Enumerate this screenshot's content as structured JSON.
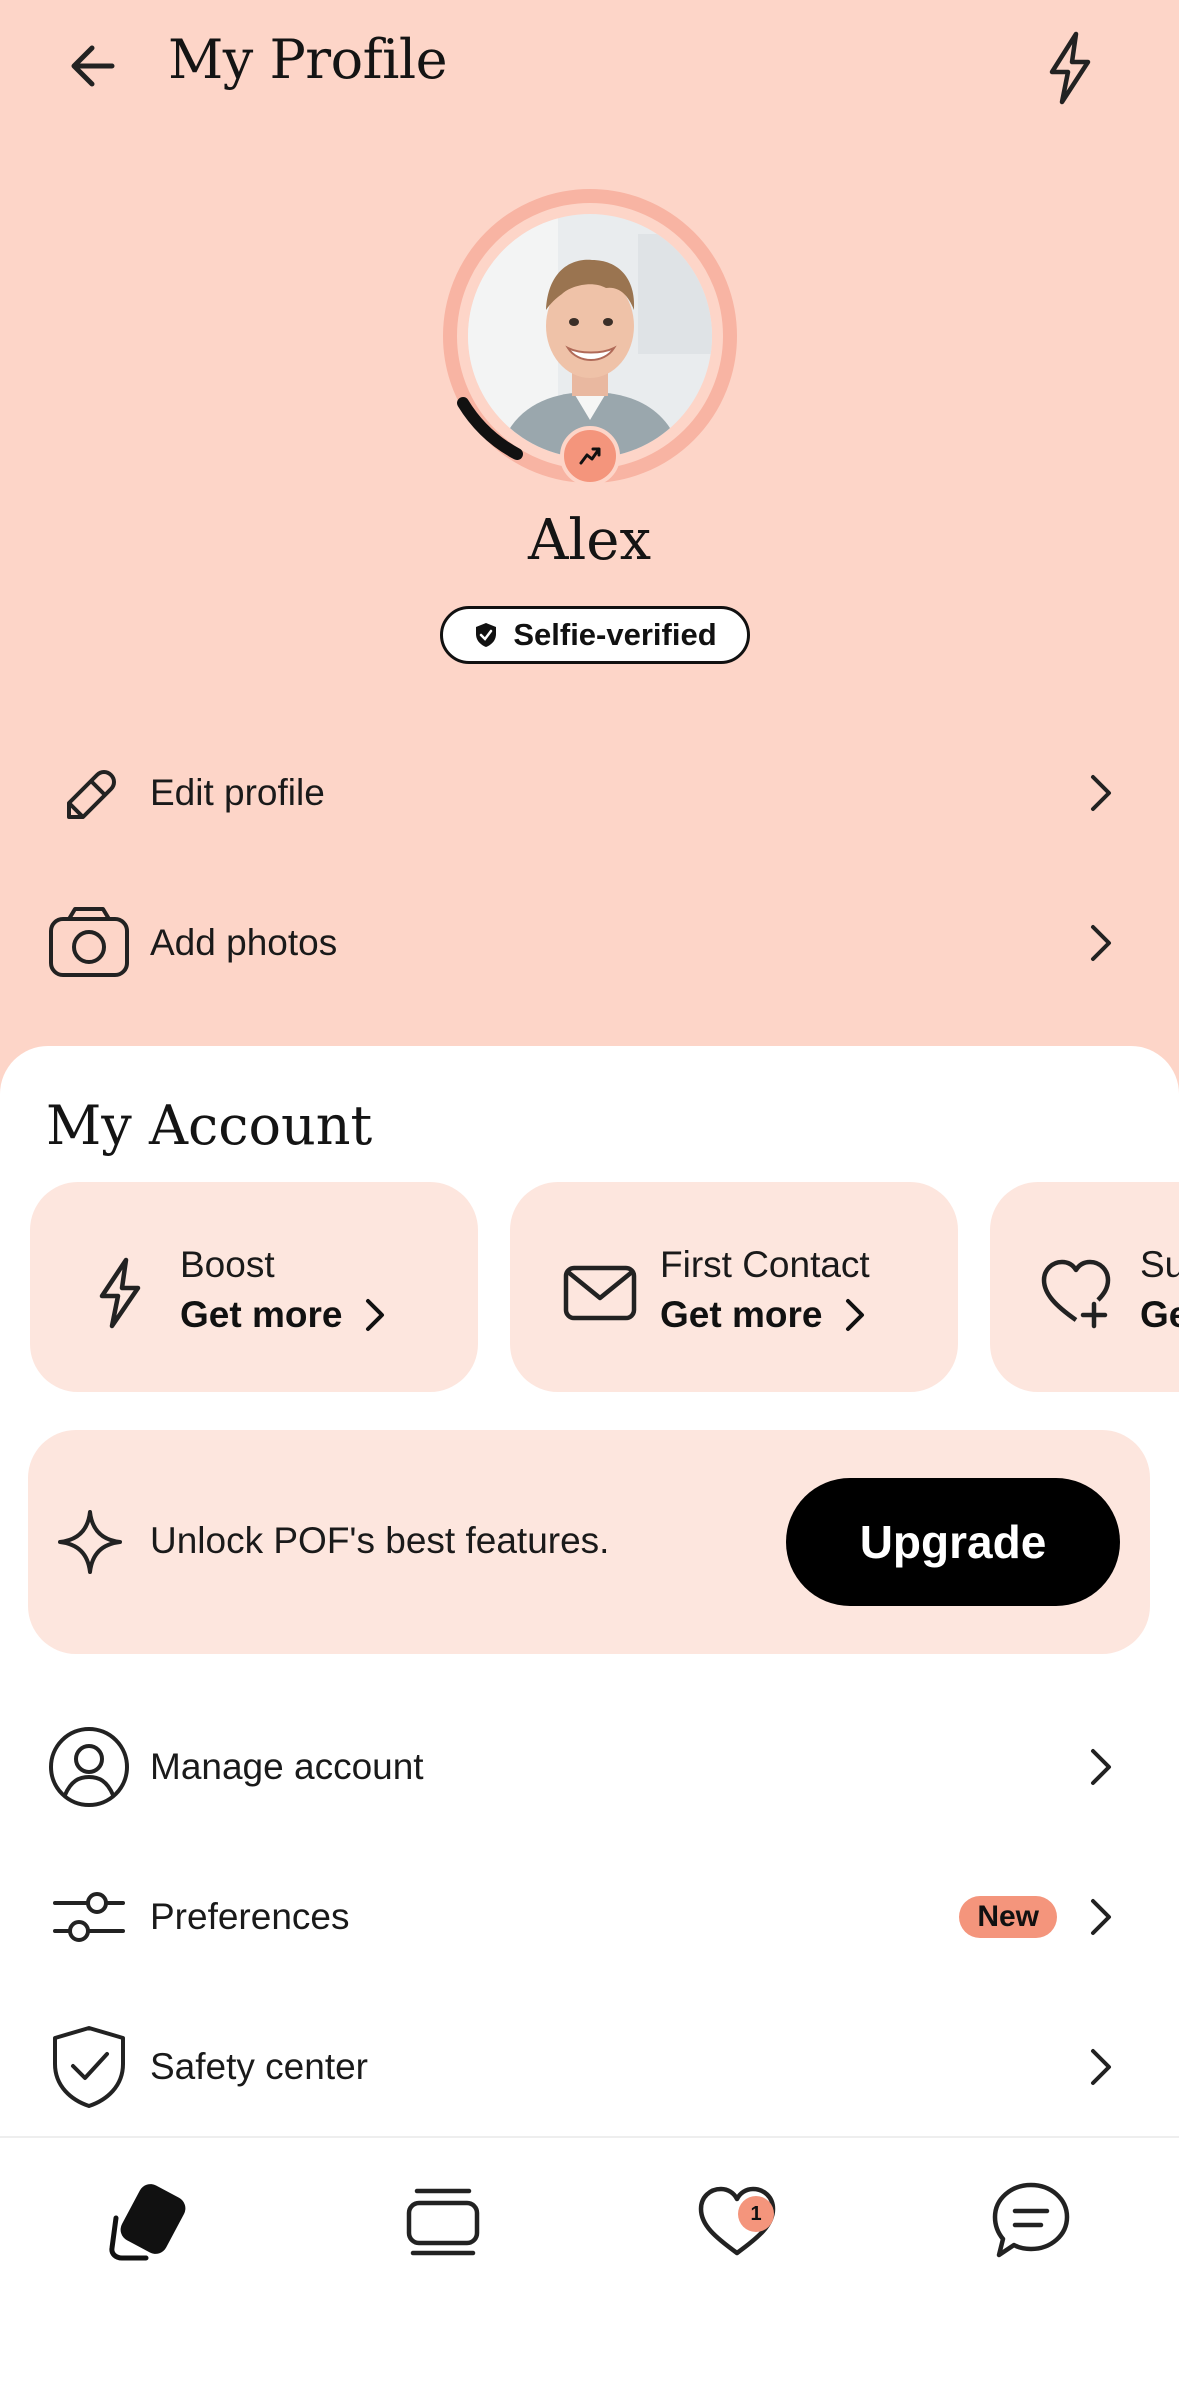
{
  "header": {
    "title": "My Profile",
    "back_icon": "arrow-left-icon",
    "boost_icon": "bolt-icon"
  },
  "profile": {
    "name": "Alex",
    "verified_label": "Selfie-verified",
    "photo_alt": "profile-photo",
    "completion_level": 0.12
  },
  "profile_actions": [
    {
      "label": "Edit profile",
      "icon": "pencil-icon"
    },
    {
      "label": "Add photos",
      "icon": "camera-icon"
    }
  ],
  "account": {
    "title": "My Account",
    "cards": [
      {
        "title": "Boost",
        "action": "Get more",
        "icon": "bolt-icon"
      },
      {
        "title": "First Contact",
        "action": "Get more",
        "icon": "envelope-icon"
      },
      {
        "title": "Su",
        "action": "Ge",
        "icon": "heart-plus-icon"
      }
    ],
    "promo": {
      "text": "Unlock POF's best features.",
      "button": "Upgrade",
      "icon": "sparkle-icon"
    },
    "menu": [
      {
        "label": "Manage account",
        "icon": "user-circle-icon"
      },
      {
        "label": "Preferences",
        "icon": "sliders-icon",
        "badge": "New"
      },
      {
        "label": "Safety center",
        "icon": "shield-check-icon"
      }
    ]
  },
  "tabbar": {
    "items": [
      "cards-icon",
      "stack-icon",
      "heart-icon",
      "chat-icon"
    ],
    "likes_count": "1"
  },
  "colors": {
    "top_bg": "#fdd5c8",
    "card_bg": "#fde6de",
    "accent": "#f4957c",
    "dark": "#000000"
  }
}
